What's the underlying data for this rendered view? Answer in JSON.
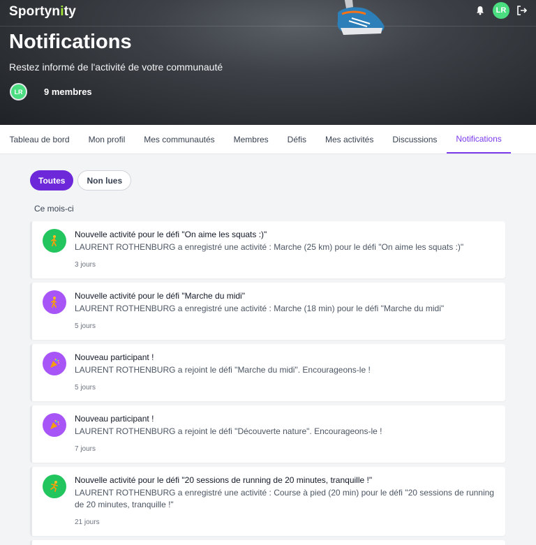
{
  "brand": {
    "name_main": "Sportyn",
    "name_dot": "i",
    "name_end": "ty"
  },
  "header": {
    "avatar_initials": "LR",
    "title": "Notifications",
    "subtitle": "Restez informé de l'activité de votre communauté",
    "member_avatar_initials": "LR",
    "members_label": "9 membres"
  },
  "nav": {
    "tabs": [
      {
        "label": "Tableau de bord"
      },
      {
        "label": "Mon profil"
      },
      {
        "label": "Mes communautés"
      },
      {
        "label": "Membres"
      },
      {
        "label": "Défis"
      },
      {
        "label": "Mes activités"
      },
      {
        "label": "Discussions"
      },
      {
        "label": "Notifications",
        "active": true
      }
    ]
  },
  "filters": {
    "all_label": "Toutes",
    "unread_label": "Non lues"
  },
  "section_label": "Ce mois-ci",
  "colors": {
    "accent": "#7c3aed",
    "green": "#22c55e",
    "purple": "#a855f7"
  },
  "notifications": [
    {
      "icon": "walking-person-icon",
      "color": "#22c55e",
      "title": "Nouvelle activité pour le défi \"On aime les squats :)\"",
      "body": "LAURENT ROTHENBURG a enregistré une activité : Marche (25 km) pour le défi \"On aime les squats :)\"",
      "time": "3 jours"
    },
    {
      "icon": "walking-person-icon",
      "color": "#a855f7",
      "title": "Nouvelle activité pour le défi \"Marche du midi\"",
      "body": "LAURENT ROTHENBURG a enregistré une activité : Marche (18 min) pour le défi \"Marche du midi\"",
      "time": "5 jours"
    },
    {
      "icon": "celebration-icon",
      "color": "#a855f7",
      "title": "Nouveau participant !",
      "body": "LAURENT ROTHENBURG a rejoint le défi \"Marche du midi\". Encourageons-le !",
      "time": "5 jours"
    },
    {
      "icon": "celebration-icon",
      "color": "#a855f7",
      "title": "Nouveau participant !",
      "body": "LAURENT ROTHENBURG a rejoint le défi \"Découverte nature\". Encourageons-le !",
      "time": "7 jours"
    },
    {
      "icon": "running-person-icon",
      "color": "#22c55e",
      "title": "Nouvelle activité pour le défi \"20 sessions de running de 20 minutes, tranquille !\"",
      "body": "LAURENT ROTHENBURG a enregistré une activité : Course à pied (20 min) pour le défi \"20 sessions de running de 20 minutes, tranquille !\"",
      "time": "21 jours"
    }
  ]
}
